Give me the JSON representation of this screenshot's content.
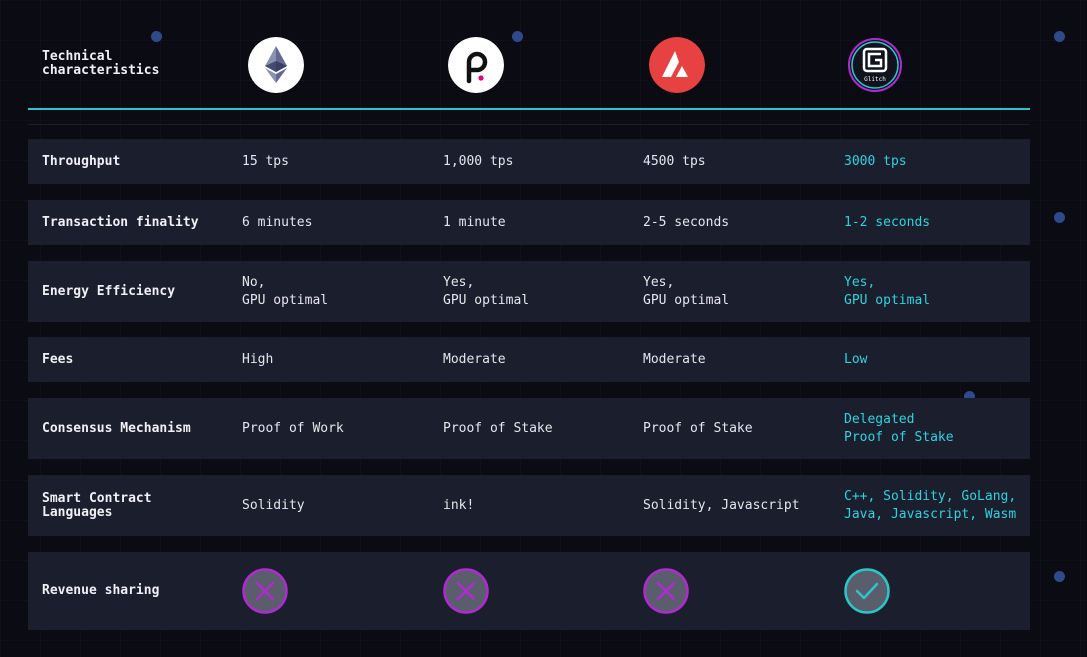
{
  "header": {
    "title": "Technical\ncharacteristics",
    "logos": [
      {
        "icon": "ethereum-logo-icon"
      },
      {
        "icon": "polkadot-logo-icon"
      },
      {
        "icon": "avalanche-logo-icon"
      },
      {
        "icon": "glitch-logo-icon",
        "text": "Glitch"
      }
    ]
  },
  "colors": {
    "background": "#0b0c13",
    "row": "#1b1e2c",
    "accent": "#2ed3e0",
    "cross": "#b12ad1",
    "check": "#29c7c9"
  },
  "rows": [
    {
      "label": "Throughput",
      "values": [
        "15 tps",
        "1,000 tps",
        "4500 tps",
        "3000 tps"
      ]
    },
    {
      "label": "Transaction finality",
      "values": [
        "6 minutes",
        "1 minute",
        "2-5 seconds",
        "1-2 seconds"
      ]
    },
    {
      "label": "Energy Efficiency",
      "values": [
        "No,\nGPU optimal",
        "Yes,\nGPU optimal",
        "Yes,\nGPU optimal",
        "Yes,\nGPU optimal"
      ]
    },
    {
      "label": "Fees",
      "values": [
        "High",
        "Moderate",
        "Moderate",
        "Low"
      ]
    },
    {
      "label": "Consensus Mechanism",
      "values": [
        "Proof of Work",
        "Proof of Stake",
        "Proof of Stake",
        "Delegated\nProof of Stake"
      ]
    },
    {
      "label": "Smart Contract\nLanguages",
      "values": [
        "Solidity",
        "ink!",
        "Solidity, Javascript",
        "C++, Solidity, GoLang,\nJava, Javascript, Wasm"
      ]
    },
    {
      "label": "Revenue sharing",
      "values_icons": [
        "cross-icon",
        "cross-icon",
        "cross-icon",
        "check-icon"
      ]
    }
  ]
}
